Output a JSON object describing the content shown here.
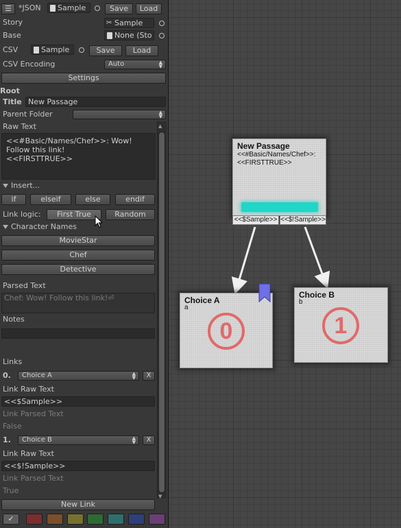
{
  "header": {
    "json_label": "*JSON",
    "json_object": "Sample",
    "save_label": "Save",
    "load_label": "Load"
  },
  "story": {
    "label": "Story",
    "value": "Sample"
  },
  "base": {
    "label": "Base",
    "value": "None (Sto"
  },
  "csv": {
    "label": "CSV",
    "object": "Sample",
    "save_label": "Save",
    "load_label": "Load"
  },
  "csv_encoding": {
    "label": "CSV Encoding",
    "value": "Auto"
  },
  "settings_label": "Settings",
  "root_label": "Root",
  "title": {
    "label": "Title",
    "value": "New Passage"
  },
  "parent_folder": {
    "label": "Parent Folder",
    "value": ""
  },
  "raw_text": {
    "label": "Raw Text",
    "lines": [
      "<<#Basic/Names/Chef>>: Wow!",
      "Follow this link!",
      "<<FIRSTTRUE>>"
    ]
  },
  "insert": {
    "label": "Insert...",
    "buttons": [
      "if",
      "elseif",
      "else",
      "endif"
    ]
  },
  "link_logic": {
    "label": "Link logic:",
    "options": [
      "First True",
      "Random"
    ]
  },
  "character_names": {
    "label": "Character Names",
    "items": [
      "MovieStar",
      "Chef",
      "Detective"
    ]
  },
  "parsed_text": {
    "label": "Parsed Text",
    "value": "Chef: Wow! Follow this link!⏎"
  },
  "notes": {
    "label": "Notes",
    "value": ""
  },
  "links": {
    "label": "Links",
    "items": [
      {
        "index": "0.",
        "target": "Choice A",
        "remove": "X",
        "raw_label": "Link Raw Text",
        "raw_value": "<<$Sample>>",
        "parsed_label": "Link Parsed Text",
        "result": "False"
      },
      {
        "index": "1.",
        "target": "Choice B",
        "remove": "X",
        "raw_label": "Link Raw Text",
        "raw_value": "<<$!Sample>>",
        "parsed_label": "Link Parsed Text",
        "result": "True"
      }
    ],
    "new_link_label": "New Link"
  },
  "color_palette": {
    "check": "✓",
    "colors": [
      "#5e5e5e",
      "#7a2e2e",
      "#7a4f2a",
      "#77712f",
      "#2f6a34",
      "#2f6e6e",
      "#2f3f7a",
      "#6a3f74"
    ]
  },
  "graph": {
    "passage_node": {
      "title": "New Passage",
      "line1": "<<#Basic/Names/Chef>>:",
      "line2": "<<FIRSTTRUE>>",
      "progress_color": "#1fd6c8",
      "link_a": "<<$Sample>>",
      "link_b": "<<$!Sample>>"
    },
    "choice_a": {
      "title": "Choice A",
      "sub": "a",
      "badge": "0",
      "bookmark_color": "#6f6fe6"
    },
    "choice_b": {
      "title": "Choice B",
      "sub": "b",
      "badge": "1"
    },
    "accent_color": "#e06a6a"
  }
}
